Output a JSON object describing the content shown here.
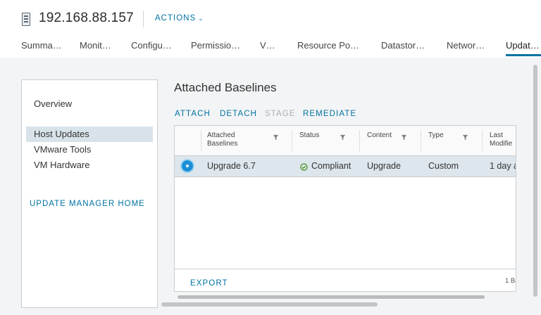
{
  "header": {
    "host_name": "192.168.88.157",
    "actions_label": "ACTIONS"
  },
  "tabs": [
    {
      "label": "Summa…"
    },
    {
      "label": "Monit…"
    },
    {
      "label": "Configu…"
    },
    {
      "label": "Permissio…"
    },
    {
      "label": "V…"
    },
    {
      "label": "Resource Po…"
    },
    {
      "label": "Datastor…"
    },
    {
      "label": "Networ…"
    },
    {
      "label": "Updat…",
      "active": true
    }
  ],
  "sidebar": {
    "items": [
      {
        "label": "Overview"
      },
      {
        "label": "Host Updates",
        "selected": true
      },
      {
        "label": "VMware Tools"
      },
      {
        "label": "VM Hardware"
      }
    ],
    "home_link": "UPDATE MANAGER HOME"
  },
  "main": {
    "title": "Attached Baselines",
    "actions": [
      {
        "label": "ATTACH",
        "enabled": true
      },
      {
        "label": "DETACH",
        "enabled": true
      },
      {
        "label": "STAGE",
        "enabled": false
      },
      {
        "label": "REMEDIATE",
        "enabled": true
      }
    ],
    "table": {
      "columns": [
        "Attached Baselines",
        "Status",
        "Content",
        "Type",
        "Last Modified"
      ],
      "columns_display": [
        [
          "Attached",
          "Baselines"
        ],
        [
          "Status",
          ""
        ],
        [
          "Content",
          ""
        ],
        [
          "Type",
          ""
        ],
        [
          "Last",
          "Modifie"
        ]
      ],
      "rows": [
        {
          "selected": true,
          "baseline": "Upgrade 6.7",
          "status": "Compliant",
          "content": "Upgrade",
          "type": "Custom",
          "last_modified": "1 day a"
        }
      ],
      "export_label": "EXPORT",
      "footer_count": "1 Ba"
    }
  },
  "colors": {
    "accent": "#0072a3",
    "selected_row": "#dde6ec",
    "compliant": "#2f8400"
  }
}
